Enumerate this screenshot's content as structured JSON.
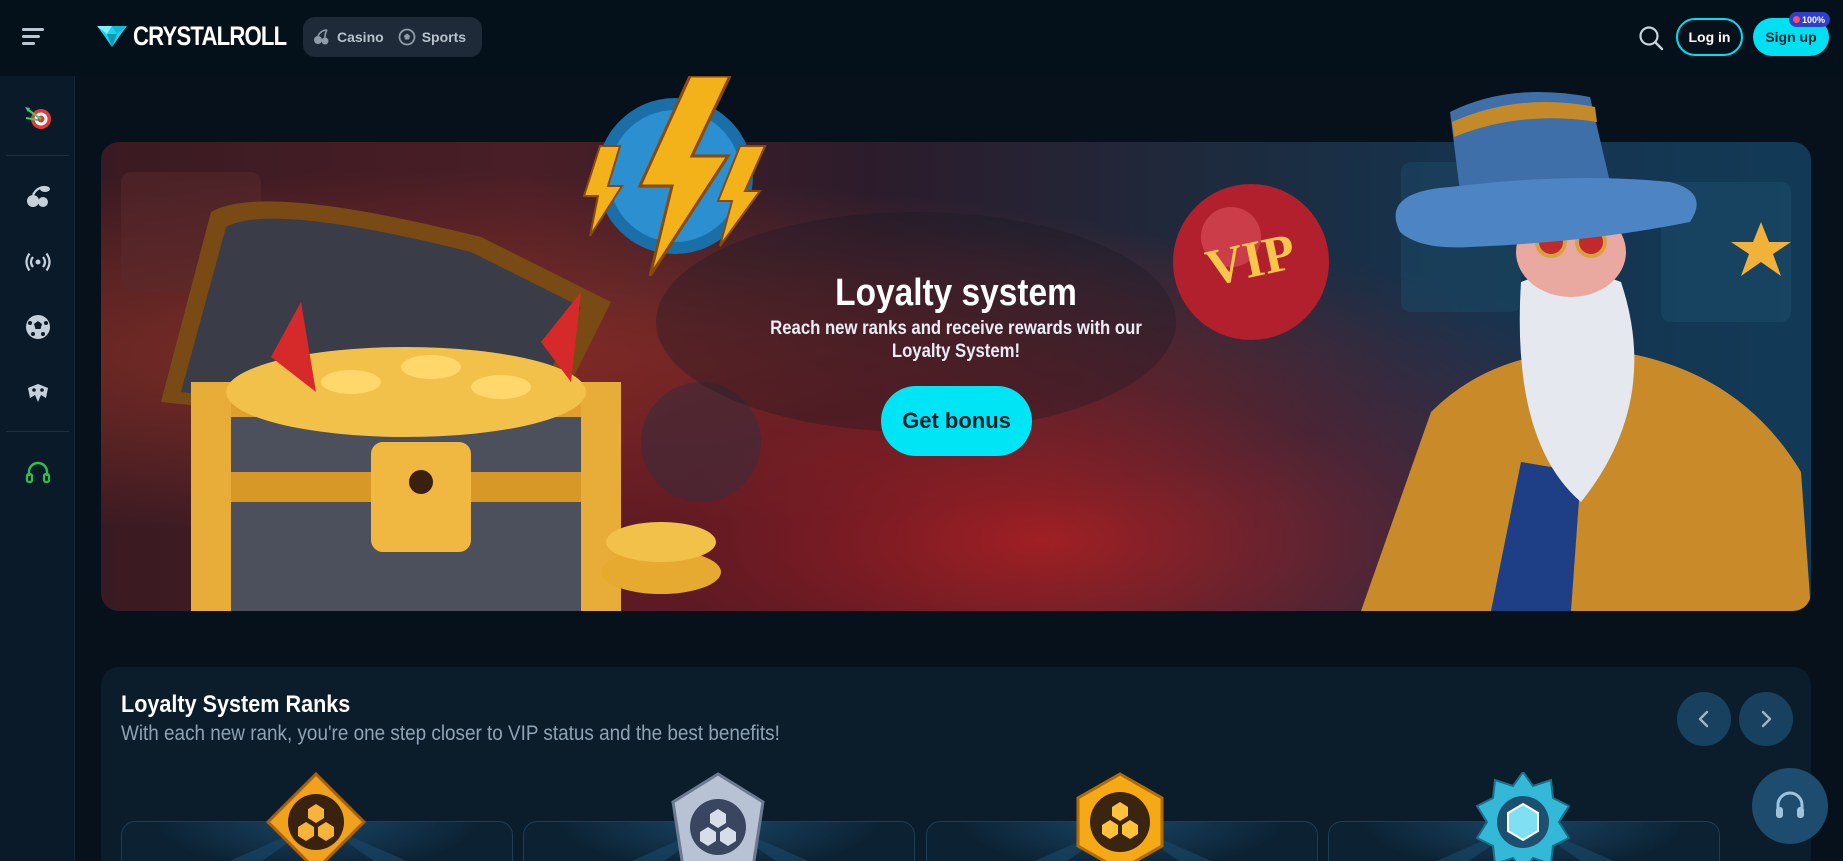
{
  "header": {
    "logo_text": "CRYSTALROLL",
    "nav": [
      {
        "label": "Casino",
        "icon": "cherries-icon"
      },
      {
        "label": "Sports",
        "icon": "soccer-ball-icon"
      }
    ],
    "login_label": "Log in",
    "signup_label": "Sign up",
    "signup_badge": "100%"
  },
  "sidebar": {
    "items": [
      {
        "name": "darts-target-icon"
      },
      {
        "name": "cherries-icon"
      },
      {
        "name": "live-broadcast-icon"
      },
      {
        "name": "soccer-ball-icon"
      },
      {
        "name": "gamepad-icon"
      },
      {
        "name": "headset-icon"
      }
    ]
  },
  "hero": {
    "title": "Loyalty system",
    "subtitle": "Reach new ranks and receive rewards with our Loyalty System!",
    "cta_label": "Get bonus",
    "vip_text": "VIP"
  },
  "ranks": {
    "title": "Loyalty System Ranks",
    "subtitle": "With each new rank, you're one step closer to VIP status and the best benefits!"
  },
  "colors": {
    "accent": "#00e0f2",
    "background": "#06111c",
    "sidebar": "#0b1a28",
    "support_green": "#2fbf4a"
  }
}
